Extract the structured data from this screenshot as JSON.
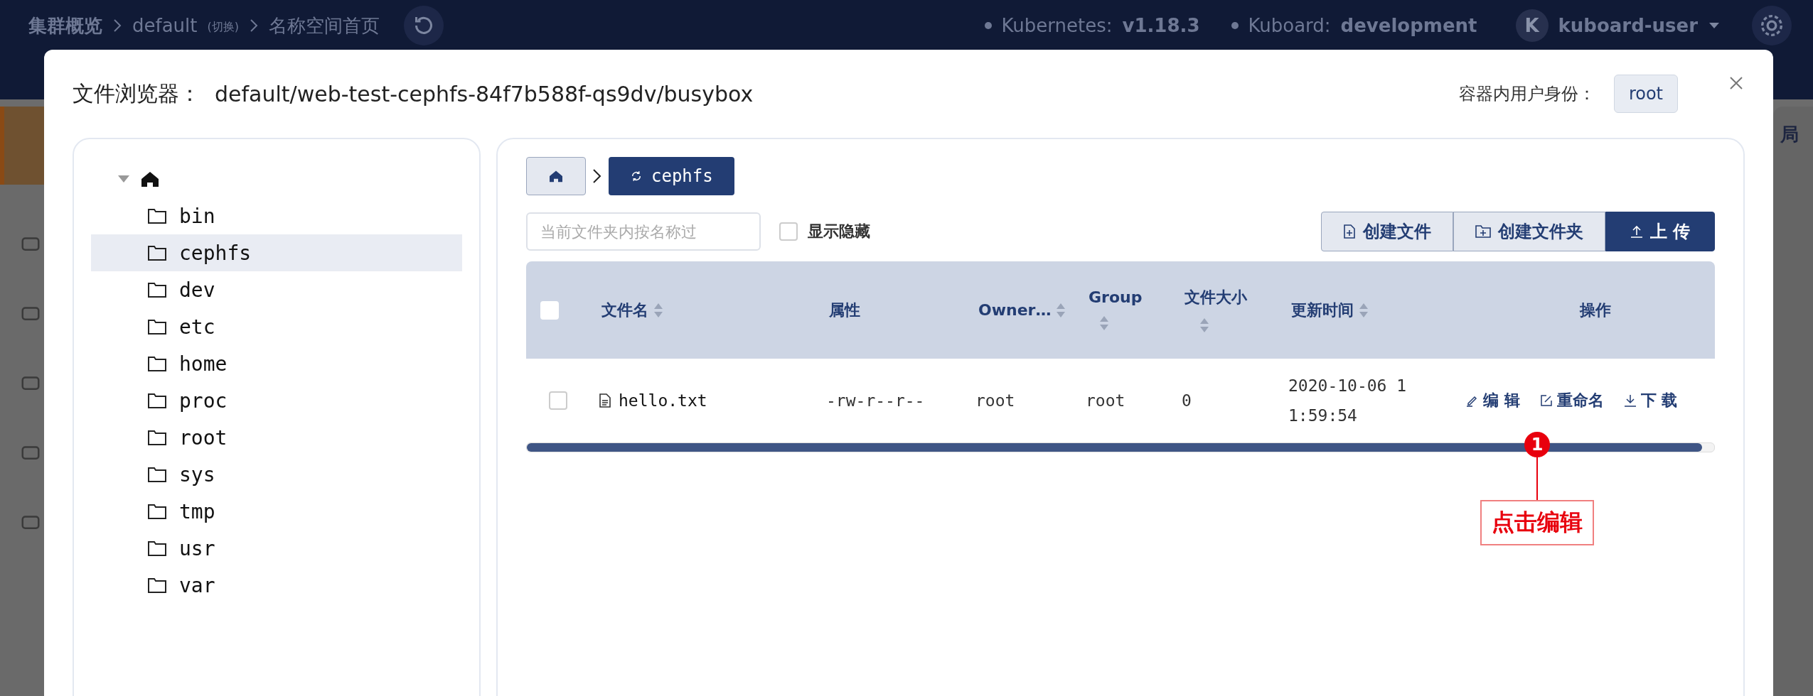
{
  "background_header": {
    "breadcrumb": [
      "集群概览",
      "default",
      "(切换)",
      "名称空间首页"
    ],
    "kubernetes_label": "Kubernetes:",
    "kubernetes_version": "v1.18.3",
    "kuboard_label": "Kuboard:",
    "kuboard_version": "development",
    "avatar_letter": "K",
    "user": "kuboard-user"
  },
  "background_side_text": "局",
  "dialog": {
    "title_label": "文件浏览器：",
    "title_path": "default/web-test-cephfs-84f7b588f-qs9dv/busybox",
    "user_label": "容器内用户身份：",
    "user_value": "root"
  },
  "tree": {
    "expanded": true,
    "children": [
      {
        "name": "bin",
        "selected": false
      },
      {
        "name": "cephfs",
        "selected": true
      },
      {
        "name": "dev",
        "selected": false
      },
      {
        "name": "etc",
        "selected": false
      },
      {
        "name": "home",
        "selected": false
      },
      {
        "name": "proc",
        "selected": false
      },
      {
        "name": "root",
        "selected": false
      },
      {
        "name": "sys",
        "selected": false
      },
      {
        "name": "tmp",
        "selected": false
      },
      {
        "name": "usr",
        "selected": false
      },
      {
        "name": "var",
        "selected": false
      }
    ]
  },
  "path_bar": {
    "current": "cephfs"
  },
  "filter": {
    "placeholder": "当前文件夹内按名称过"
  },
  "show_hidden": {
    "label": "显示隐藏",
    "checked": false
  },
  "buttons": [
    {
      "kind": "new-file",
      "label": "创建文件",
      "primary": false
    },
    {
      "kind": "new-folder",
      "label": "创建文件夹",
      "primary": false
    },
    {
      "kind": "upload",
      "label": "上 传",
      "primary": true
    }
  ],
  "table": {
    "select_all": false,
    "columns": [
      {
        "label": "文件名",
        "sortable": true
      },
      {
        "label": "属性",
        "sortable": false
      },
      {
        "label": "Owner…",
        "sortable": true
      },
      {
        "label": "Group",
        "sortable": true
      },
      {
        "label": "文件大小",
        "sortable": true
      },
      {
        "label": "更新时间",
        "sortable": true
      },
      {
        "label": "操作",
        "sortable": false
      }
    ],
    "rows": [
      {
        "checked": false,
        "name": "hello.txt",
        "attributes": "-rw-r--r--",
        "owner": "root",
        "group": "root",
        "size": "0",
        "updated": "2020-10-06 11:59:54",
        "actions": [
          {
            "kind": "edit",
            "label": "编 辑"
          },
          {
            "kind": "rename",
            "label": "重命名"
          },
          {
            "kind": "download",
            "label": "下 载"
          }
        ]
      }
    ]
  },
  "annotation": {
    "number": "1",
    "text": "点击编辑"
  }
}
